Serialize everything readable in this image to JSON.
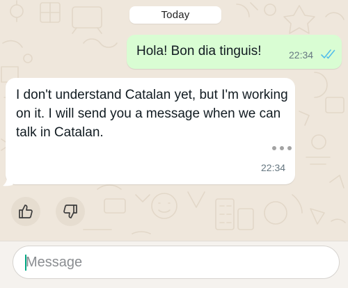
{
  "chat": {
    "date_label": "Today",
    "messages": [
      {
        "direction": "outgoing",
        "text": "Hola! Bon dia tinguis!",
        "time": "22:34",
        "status_icon": "double-check-icon"
      },
      {
        "direction": "incoming",
        "text": "I don't understand Catalan yet, but I'm working on it. I will send you a message when we can talk in Catalan.",
        "time": "22:34",
        "more_icon": "more-dots-icon"
      }
    ],
    "reactions": [
      {
        "icon": "thumbs-up-icon"
      },
      {
        "icon": "thumbs-down-icon"
      }
    ]
  },
  "composer": {
    "placeholder": "Message"
  },
  "colors": {
    "outgoing_bubble": "#d9fdd3",
    "incoming_bubble": "#ffffff",
    "read_ticks": "#53bdeb",
    "caret": "#00a884",
    "chat_background": "#efe7dc"
  }
}
